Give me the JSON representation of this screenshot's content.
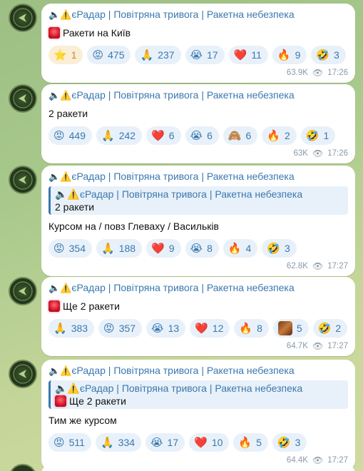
{
  "messages": [
    {
      "sender": "єРадар | Повітряна тривога | Ракетна небезпека",
      "text": "Ракети на Київ",
      "has_siren": true,
      "reply": null,
      "reactions": [
        {
          "emoji": "⭐",
          "count": "1",
          "gold": true
        },
        {
          "emoji": "😡",
          "count": "475"
        },
        {
          "emoji": "🙏",
          "count": "237"
        },
        {
          "emoji": "😭",
          "count": "17"
        },
        {
          "emoji": "❤️",
          "count": "11"
        },
        {
          "emoji": "🔥",
          "count": "9"
        },
        {
          "emoji": "🤣",
          "count": "3"
        }
      ],
      "views": "63.9K",
      "time": "17:26"
    },
    {
      "sender": "єРадар | Повітряна тривога | Ракетна небезпека",
      "text": "2 ракети",
      "has_siren": false,
      "reply": null,
      "reactions": [
        {
          "emoji": "😡",
          "count": "449"
        },
        {
          "emoji": "🙏",
          "count": "242"
        },
        {
          "emoji": "❤️",
          "count": "6"
        },
        {
          "emoji": "😭",
          "count": "6"
        },
        {
          "emoji": "🙈",
          "count": "6"
        },
        {
          "emoji": "🔥",
          "count": "2"
        },
        {
          "emoji": "🤣",
          "count": "1"
        }
      ],
      "views": "63K",
      "time": "17:26"
    },
    {
      "sender": "єРадар | Повітряна тривога | Ракетна небезпека",
      "text": "Курсом на / повз Глеваху / Васильків",
      "has_siren": false,
      "reply": {
        "sender": "єРадар | Повітряна тривога | Ракетна небезпека",
        "text": "2 ракети",
        "has_siren": false
      },
      "reactions": [
        {
          "emoji": "😡",
          "count": "354"
        },
        {
          "emoji": "🙏",
          "count": "188"
        },
        {
          "emoji": "❤️",
          "count": "9"
        },
        {
          "emoji": "😭",
          "count": "8"
        },
        {
          "emoji": "🔥",
          "count": "4"
        },
        {
          "emoji": "🤣",
          "count": "3"
        }
      ],
      "views": "62.8K",
      "time": "17:27"
    },
    {
      "sender": "єРадар | Повітряна тривога | Ракетна небезпека",
      "text": "Ще 2 ракети",
      "has_siren": true,
      "reply": null,
      "reactions": [
        {
          "emoji": "🙏",
          "count": "383"
        },
        {
          "emoji": "😡",
          "count": "357"
        },
        {
          "emoji": "😭",
          "count": "13"
        },
        {
          "emoji": "❤️",
          "count": "12"
        },
        {
          "emoji": "🔥",
          "count": "8"
        },
        {
          "emoji": "custom-sticker",
          "count": "5",
          "picture": true
        },
        {
          "emoji": "🤣",
          "count": "2"
        }
      ],
      "views": "64.7K",
      "time": "17:27"
    },
    {
      "sender": "єРадар | Повітряна тривога | Ракетна небезпека",
      "text": "Тим же курсом",
      "has_siren": false,
      "reply": {
        "sender": "єРадар | Повітряна тривога | Ракетна небезпека",
        "text": "Ще 2 ракети",
        "has_siren": true
      },
      "reactions": [
        {
          "emoji": "😡",
          "count": "511"
        },
        {
          "emoji": "🙏",
          "count": "334"
        },
        {
          "emoji": "😭",
          "count": "17"
        },
        {
          "emoji": "❤️",
          "count": "10"
        },
        {
          "emoji": "🔥",
          "count": "5"
        },
        {
          "emoji": "🤣",
          "count": "3"
        }
      ],
      "views": "64.4K",
      "time": "17:27"
    }
  ],
  "sender_icons": "🔈⚠️",
  "views_icon": "eye-icon",
  "colors": {
    "accent": "#3a78b0",
    "reaction_bg": "#e8f1f9",
    "bubble_bg": "#ffffff",
    "meta": "#8a9aa8"
  }
}
